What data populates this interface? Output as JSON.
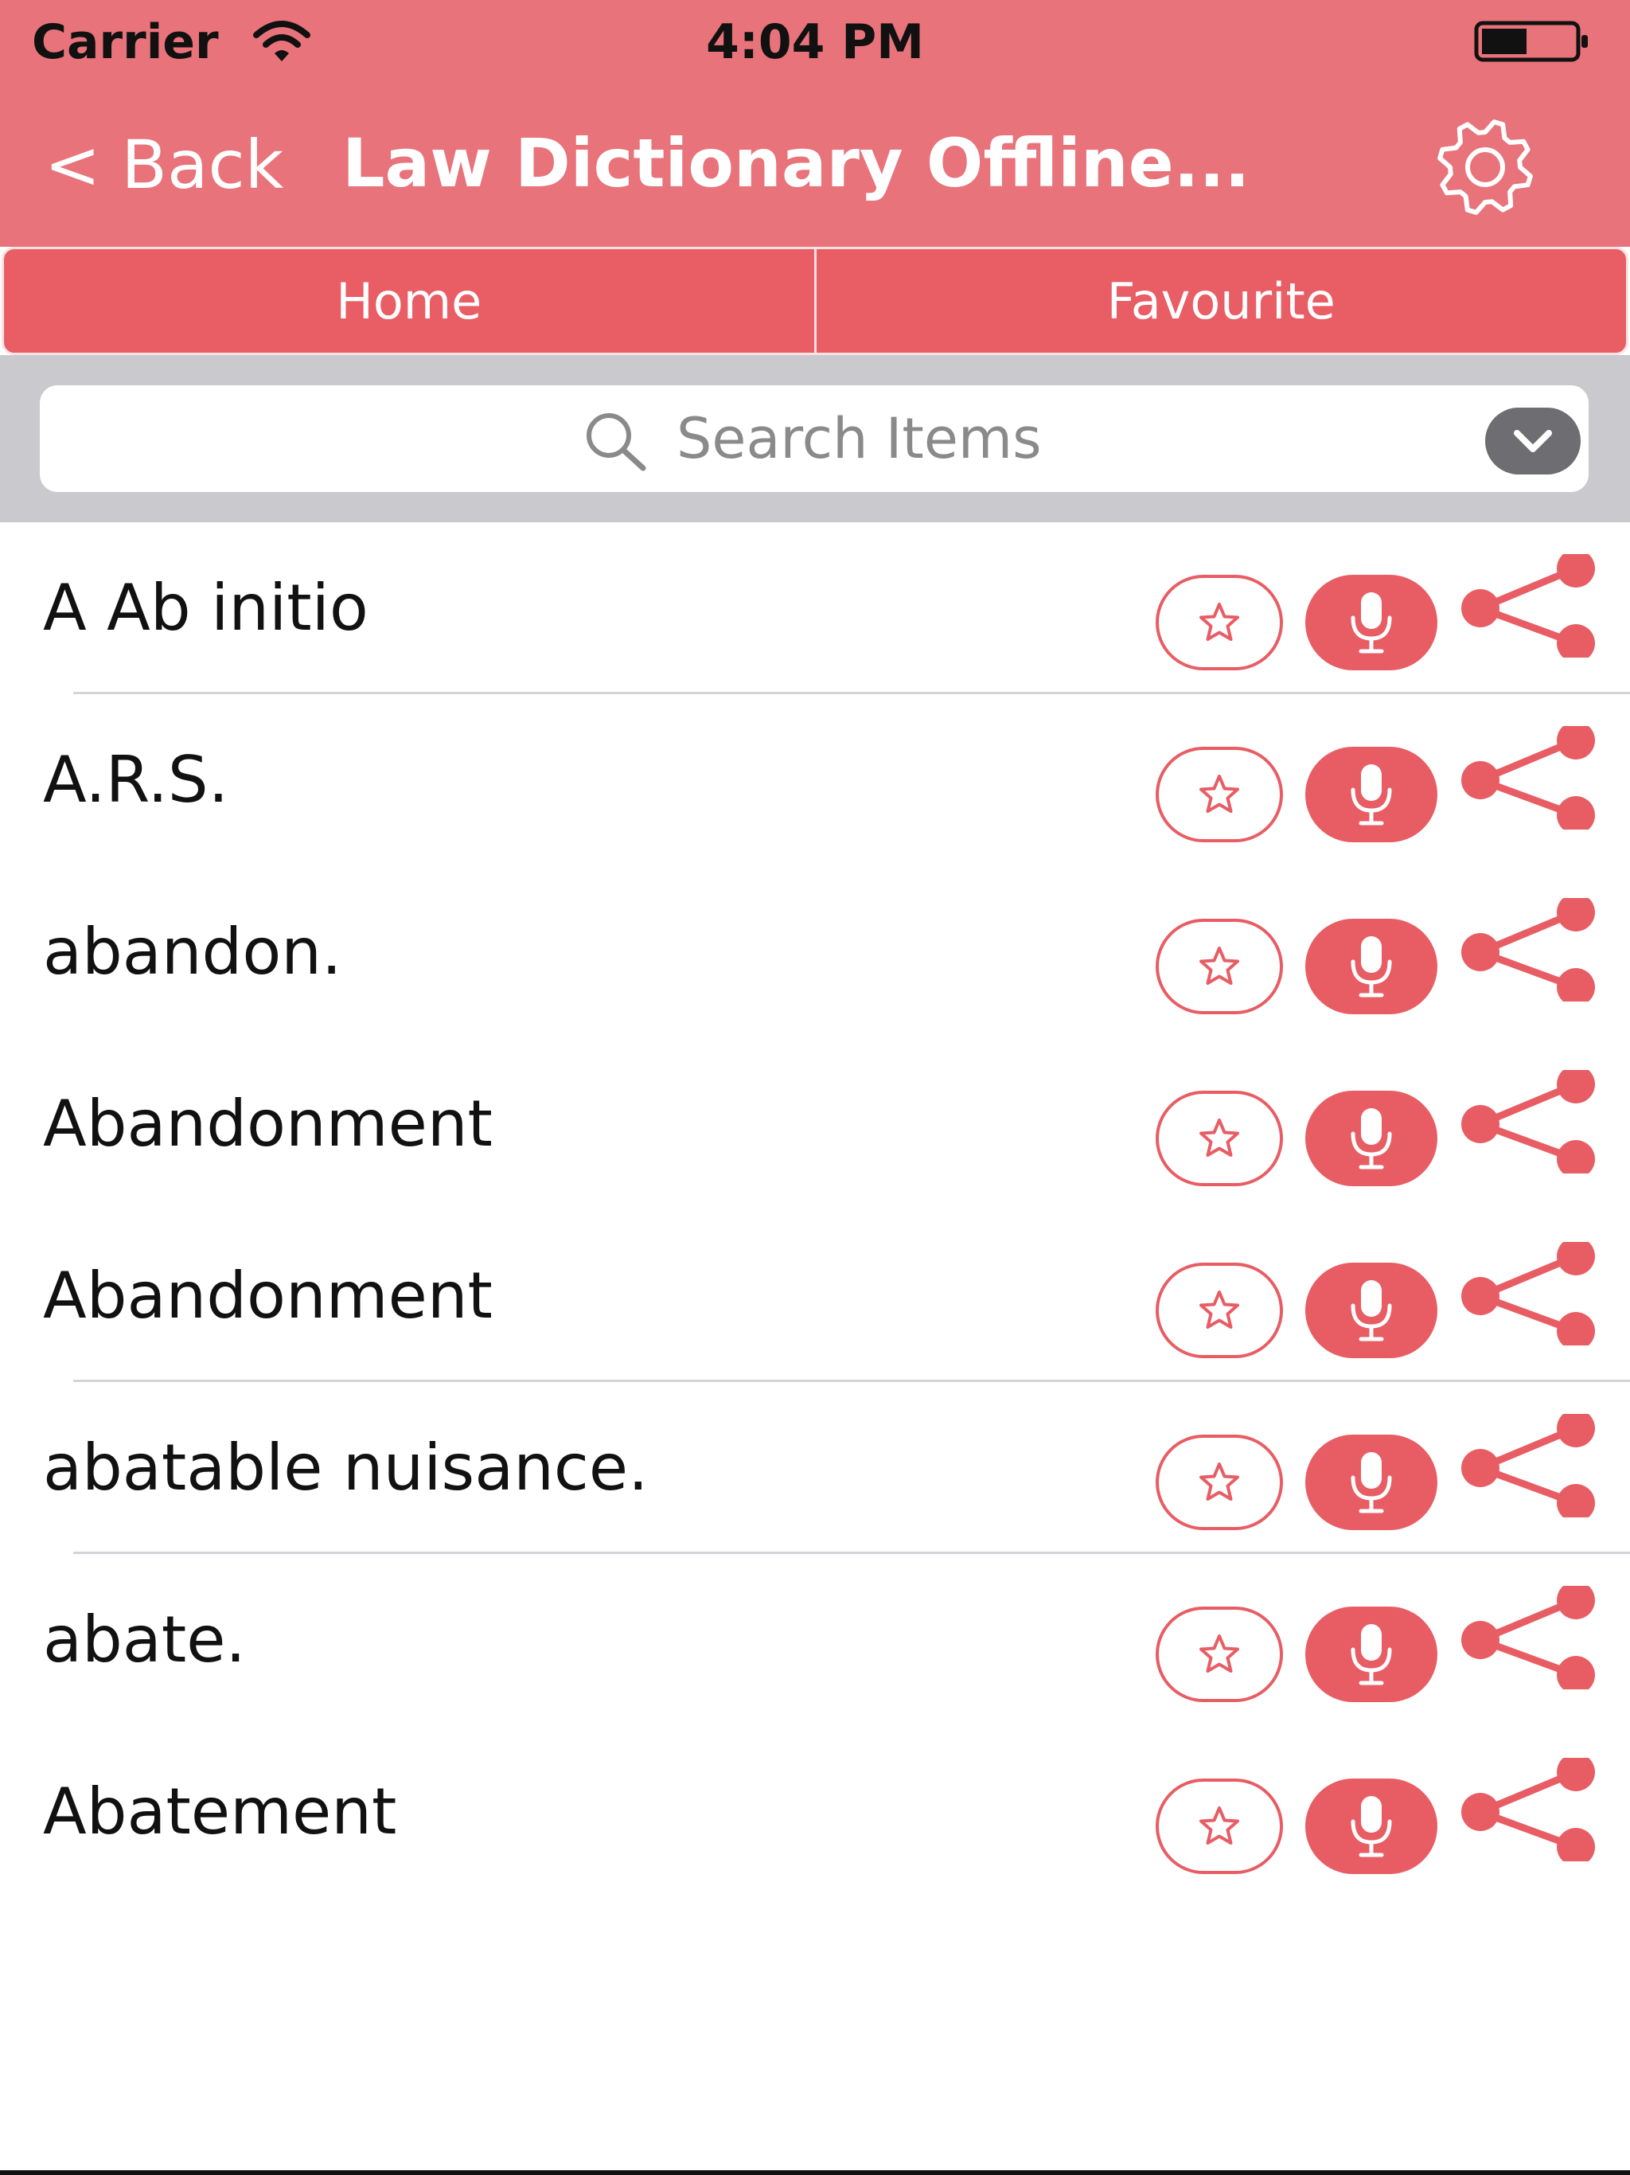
{
  "status_bar": {
    "carrier": "Carrier",
    "time": "4:04 PM",
    "icons": [
      "wifi-icon",
      "battery-icon"
    ]
  },
  "nav": {
    "back_label": "Back",
    "title": "Law Dictionary Offline...",
    "settings_icon": "gear-icon"
  },
  "tabs": [
    {
      "label": "Home"
    },
    {
      "label": "Favourite"
    }
  ],
  "search": {
    "placeholder": "Search Items",
    "value": "",
    "icon": "search-icon",
    "toggle_icon": "chevron-down-icon"
  },
  "list": {
    "items": [
      {
        "term": "A Ab initio"
      },
      {
        "term": "A.R.S."
      },
      {
        "term": "abandon."
      },
      {
        "term": "Abandonment"
      },
      {
        "term": "Abandonment"
      },
      {
        "term": "abatable nuisance."
      },
      {
        "term": "abate."
      },
      {
        "term": "Abatement"
      }
    ],
    "row_actions": [
      "star-icon",
      "microphone-icon",
      "share-icon"
    ]
  },
  "colors": {
    "header": "#e8737a",
    "tab_bar": "#e95d65",
    "accent": "#e85d64",
    "search_background": "#c9c9ce"
  }
}
